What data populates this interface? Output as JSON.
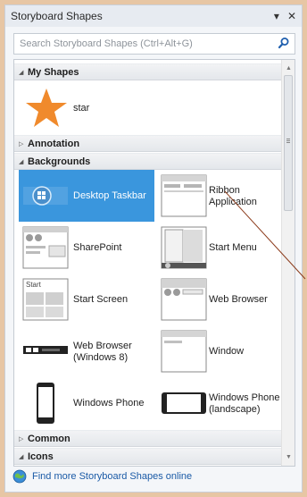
{
  "pane": {
    "title": "Storyboard Shapes",
    "dropdown_glyph": "▾",
    "close_glyph": "✕"
  },
  "search": {
    "placeholder": "Search Storyboard Shapes (Ctrl+Alt+G)"
  },
  "sections": [
    {
      "label": "My Shapes",
      "expanded": true
    },
    {
      "label": "Annotation",
      "expanded": false
    },
    {
      "label": "Backgrounds",
      "expanded": true
    },
    {
      "label": "Common",
      "expanded": false
    },
    {
      "label": "Icons",
      "expanded": true
    }
  ],
  "my_shapes": [
    {
      "label": "star",
      "icon": "star-icon",
      "color": "#f08a2c"
    }
  ],
  "backgrounds": [
    {
      "label": "Desktop Taskbar",
      "icon": "desktop-taskbar-icon",
      "selected": true
    },
    {
      "label": "Ribbon Application",
      "icon": "ribbon-application-icon",
      "selected": false
    },
    {
      "label": "SharePoint",
      "icon": "sharepoint-icon",
      "selected": false
    },
    {
      "label": "Start Menu",
      "icon": "start-menu-icon",
      "selected": false
    },
    {
      "label": "Start Screen",
      "icon": "start-screen-icon",
      "selected": false,
      "thumb_text": "Start"
    },
    {
      "label": "Web Browser",
      "icon": "web-browser-icon",
      "selected": false
    },
    {
      "label": "Web Browser (Windows 8)",
      "icon": "web-browser-win8-icon",
      "selected": false
    },
    {
      "label": "Window",
      "icon": "window-icon",
      "selected": false
    },
    {
      "label": "Windows Phone",
      "icon": "windows-phone-icon",
      "selected": false
    },
    {
      "label": "Windows Phone (landscape)",
      "icon": "windows-phone-landscape-icon",
      "selected": false
    }
  ],
  "footer": {
    "link_label": "Find more Storyboard Shapes online",
    "icon": "globe-icon"
  },
  "colors": {
    "accent": "#3a96dd",
    "link": "#1a5aa6",
    "callout_line": "#8b3a1a",
    "star": "#f08a2c"
  }
}
